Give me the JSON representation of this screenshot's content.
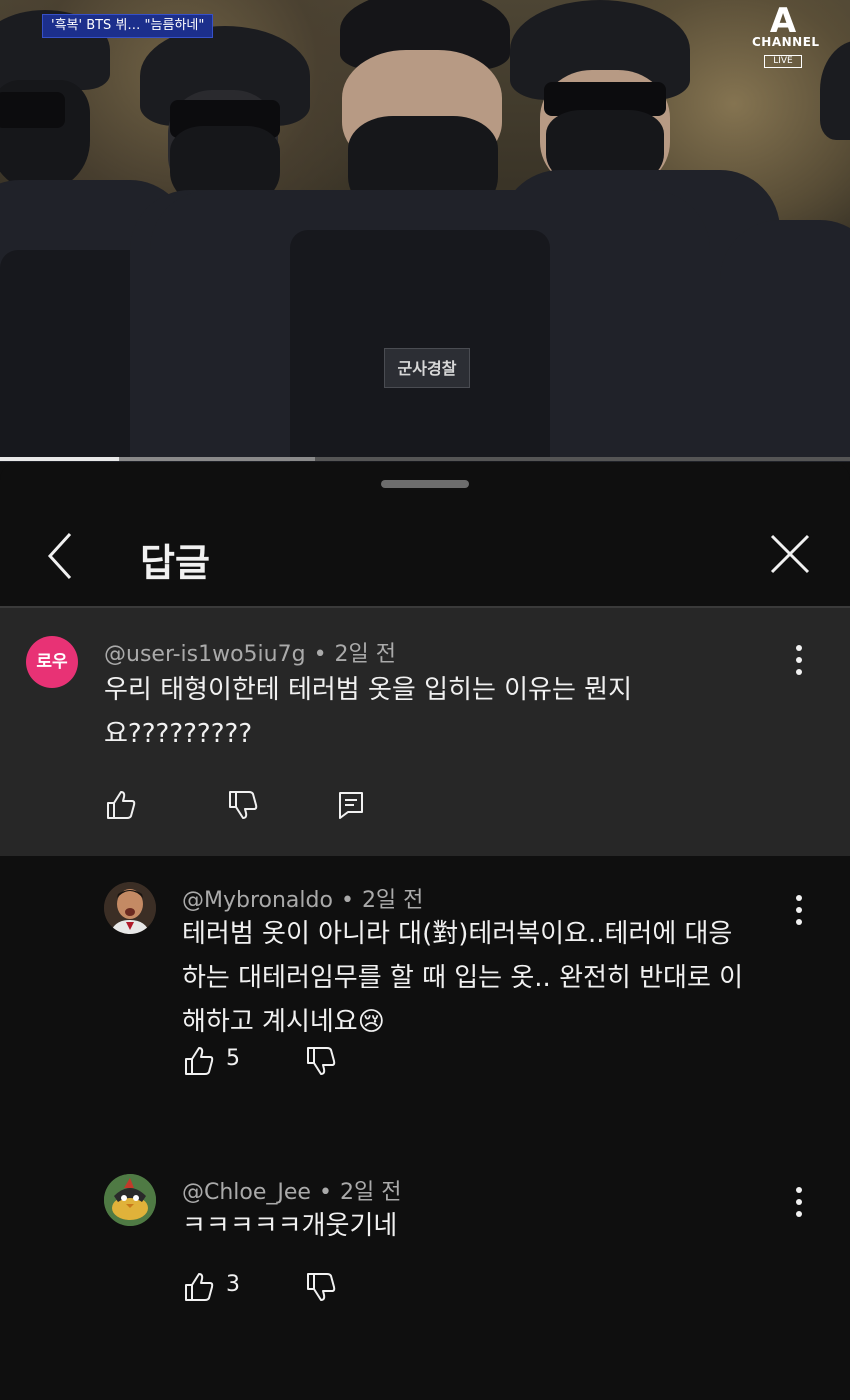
{
  "video": {
    "news_tag_prefix": "'흑복' BTS 뷔…",
    "news_tag_suffix": "\"늠름하네\"",
    "patch_text": "군사경찰",
    "channel_mark": "A",
    "channel_name": "CHANNEL",
    "live_badge": "LIVE",
    "progress_played": 0.14,
    "progress_buffered": 0.37
  },
  "sheet": {
    "title": "답글",
    "back_icon": "chevron-left-icon",
    "close_icon": "close-icon"
  },
  "parent_comment": {
    "avatar_text": "로우",
    "author": "@user-is1wo5iu7g",
    "time": "2일 전",
    "text_line1": "우리 태형이한테 테러범 옷을 입히는 이유는 뭔지",
    "text_line2": "요?????????",
    "actions": [
      "like-icon",
      "dislike-icon",
      "reply-icon"
    ]
  },
  "replies": [
    {
      "author": "@Mybronaldo",
      "time": "2일 전",
      "text_line1": "테러범 옷이 아니라 대(對)테러복이요..테러에 대응",
      "text_line2": "하는 대테러임무를 할 때 입는 옷.. 완전히 반대로 이",
      "text_line3": "해하고 계시네요😢",
      "likes": "5"
    },
    {
      "author": "@Chloe_Jee",
      "time": "2일 전",
      "text_line1": "ㅋㅋㅋㅋㅋ개웃기네",
      "likes": "3"
    }
  ],
  "separator": "•",
  "colors": {
    "background": "#0f0f0f",
    "highlight": "#272727",
    "avatar_pink": "#e83275",
    "meta_gray": "#aaaaaa"
  }
}
